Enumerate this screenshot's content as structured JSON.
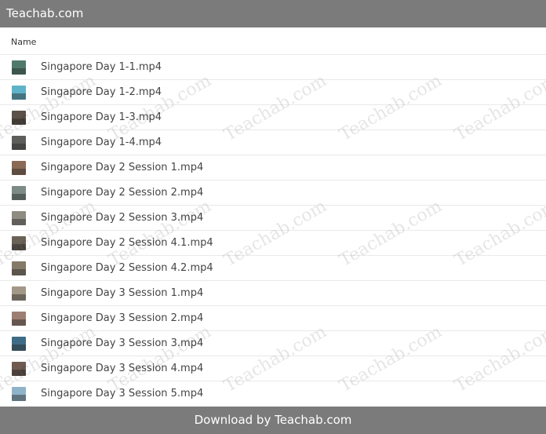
{
  "header": {
    "title": "Teachab.com"
  },
  "list": {
    "column_name": "Name",
    "files": [
      {
        "name": "Singapore Day 1-1.mp4",
        "thumb": "#4f7a6b"
      },
      {
        "name": "Singapore Day 1-2.mp4",
        "thumb": "#5fb3c8"
      },
      {
        "name": "Singapore Day 1-3.mp4",
        "thumb": "#5b5148"
      },
      {
        "name": "Singapore Day 1-4.mp4",
        "thumb": "#5d5d5b"
      },
      {
        "name": "Singapore Day 2 Session 1.mp4",
        "thumb": "#8a6a55"
      },
      {
        "name": "Singapore Day 2 Session 2.mp4",
        "thumb": "#7d8a86"
      },
      {
        "name": "Singapore Day 2 Session 3.mp4",
        "thumb": "#8f8c82"
      },
      {
        "name": "Singapore Day 2 Session 4.1.mp4",
        "thumb": "#6b6257"
      },
      {
        "name": "Singapore Day 2 Session 4.2.mp4",
        "thumb": "#857a68"
      },
      {
        "name": "Singapore Day 3 Session 1.mp4",
        "thumb": "#a39887"
      },
      {
        "name": "Singapore Day 3 Session 2.mp4",
        "thumb": "#9c7f72"
      },
      {
        "name": "Singapore Day 3 Session 3.mp4",
        "thumb": "#3e6c86"
      },
      {
        "name": "Singapore Day 3 Session 4.mp4",
        "thumb": "#6e5a50"
      },
      {
        "name": "Singapore Day 3 Session 5.mp4",
        "thumb": "#8fb3c9"
      }
    ]
  },
  "watermark": {
    "text": "Teachab.com"
  },
  "footer": {
    "text": "Download by Teachab.com"
  }
}
